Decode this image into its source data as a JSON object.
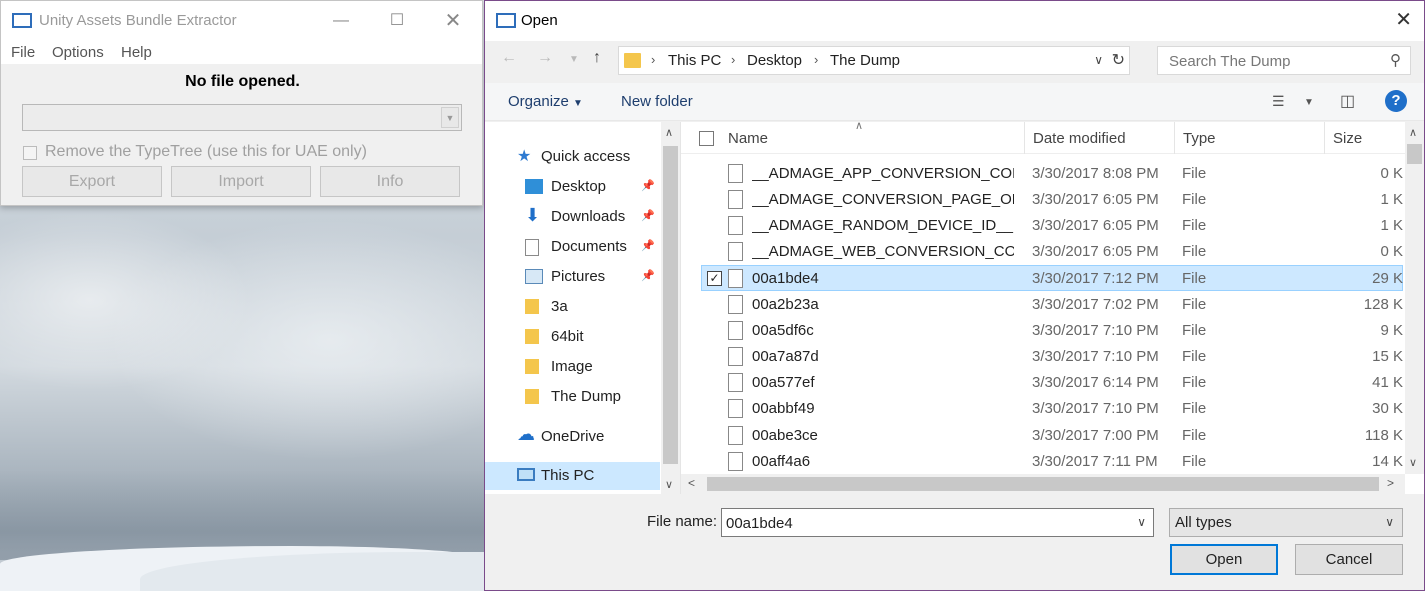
{
  "uabe": {
    "title": "Unity Assets Bundle Extractor",
    "menus": [
      "File",
      "Options",
      "Help"
    ],
    "status": "No file opened.",
    "checkbox_label": "Remove the TypeTree (use this for UAE only)",
    "buttons": {
      "export": "Export",
      "import": "Import",
      "info": "Info"
    }
  },
  "dialog": {
    "title": "Open",
    "breadcrumb": [
      "This PC",
      "Desktop",
      "The Dump"
    ],
    "search_placeholder": "Search The Dump",
    "toolbar": {
      "organize": "Organize",
      "new_folder": "New folder"
    },
    "nav": {
      "quick_access": "Quick access",
      "items": [
        {
          "label": "Desktop",
          "icon": "desktop-icon",
          "pinned": true
        },
        {
          "label": "Downloads",
          "icon": "downloads-icon",
          "pinned": true
        },
        {
          "label": "Documents",
          "icon": "documents-icon",
          "pinned": true
        },
        {
          "label": "Pictures",
          "icon": "pictures-icon",
          "pinned": true
        },
        {
          "label": "3a",
          "icon": "folder-icon",
          "pinned": false
        },
        {
          "label": "64bit",
          "icon": "folder-icon",
          "pinned": false
        },
        {
          "label": "Image",
          "icon": "folder-icon",
          "pinned": false
        },
        {
          "label": "The Dump",
          "icon": "folder-icon",
          "pinned": false
        }
      ],
      "onedrive": "OneDrive",
      "this_pc": "This PC"
    },
    "columns": {
      "name": "Name",
      "date": "Date modified",
      "type": "Type",
      "size": "Size"
    },
    "files": [
      {
        "name": "__ADMAGE_APP_CONVERSION_COM...",
        "date": "3/30/2017 8:08 PM",
        "type": "File",
        "size": "0 K"
      },
      {
        "name": "__ADMAGE_CONVERSION_PAGE_OPE...",
        "date": "3/30/2017 6:05 PM",
        "type": "File",
        "size": "1 K"
      },
      {
        "name": "__ADMAGE_RANDOM_DEVICE_ID__",
        "date": "3/30/2017 6:05 PM",
        "type": "File",
        "size": "1 K"
      },
      {
        "name": "__ADMAGE_WEB_CONVERSION_COM...",
        "date": "3/30/2017 6:05 PM",
        "type": "File",
        "size": "0 K"
      },
      {
        "name": "00a1bde4",
        "date": "3/30/2017 7:12 PM",
        "type": "File",
        "size": "29 K",
        "selected": true
      },
      {
        "name": "00a2b23a",
        "date": "3/30/2017 7:02 PM",
        "type": "File",
        "size": "128 K"
      },
      {
        "name": "00a5df6c",
        "date": "3/30/2017 7:10 PM",
        "type": "File",
        "size": "9 K"
      },
      {
        "name": "00a7a87d",
        "date": "3/30/2017 7:10 PM",
        "type": "File",
        "size": "15 K"
      },
      {
        "name": "00a577ef",
        "date": "3/30/2017 6:14 PM",
        "type": "File",
        "size": "41 K"
      },
      {
        "name": "00abbf49",
        "date": "3/30/2017 7:10 PM",
        "type": "File",
        "size": "30 K"
      },
      {
        "name": "00abe3ce",
        "date": "3/30/2017 7:00 PM",
        "type": "File",
        "size": "118 K"
      },
      {
        "name": "00aff4a6",
        "date": "3/30/2017 7:11 PM",
        "type": "File",
        "size": "14 K"
      }
    ],
    "file_name_label": "File name:",
    "file_name_value": "00a1bde4",
    "filter_value": "All types",
    "open_label": "Open",
    "cancel_label": "Cancel"
  },
  "colors": {
    "accent": "#0078d7",
    "selection": "#cde8ff",
    "folder": "#f4c64c"
  }
}
